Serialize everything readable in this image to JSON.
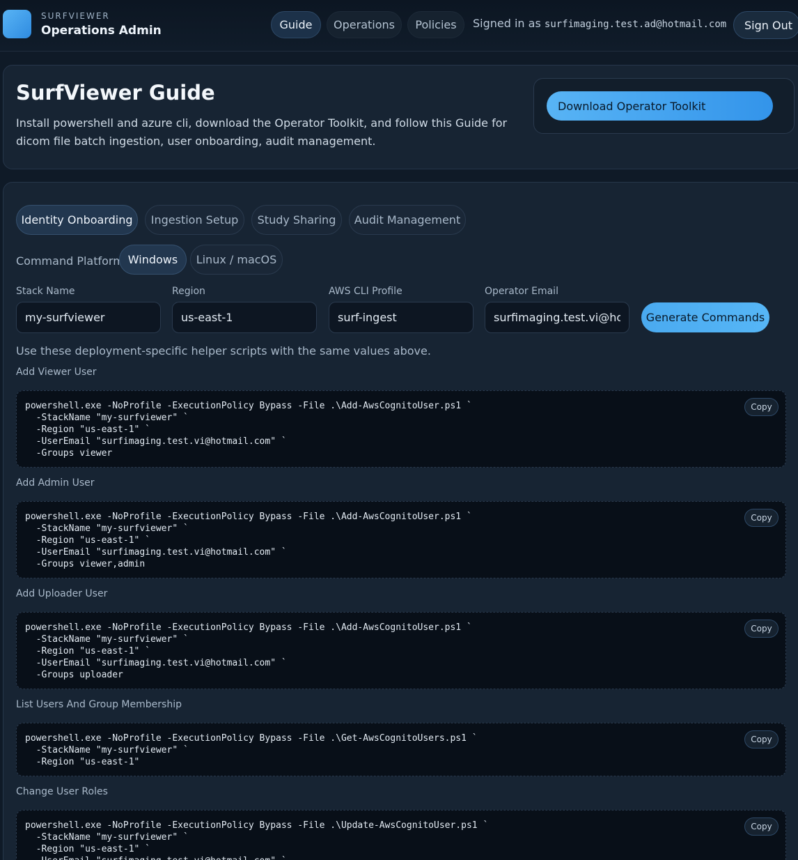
{
  "header": {
    "brand_small": "SURFVIEWER",
    "brand_title": "Operations Admin",
    "nav": [
      "Guide",
      "Operations",
      "Policies"
    ],
    "signed_prefix": "Signed in as",
    "signed_email": "surfimaging.test.ad@hotmail.com",
    "sign_out": "Sign Out"
  },
  "hero": {
    "title": "SurfViewer Guide",
    "description": "Install powershell and azure cli, download the Operator Toolkit, and follow this Guide for dicom file batch ingestion, user onboarding, audit management.",
    "download_label": "Download Operator Toolkit"
  },
  "tabs": [
    "Identity Onboarding",
    "Ingestion Setup",
    "Study Sharing",
    "Audit Management"
  ],
  "platform": {
    "label": "Command Platform",
    "options": [
      "Windows",
      "Linux / macOS"
    ]
  },
  "fields": {
    "stack_name": {
      "label": "Stack Name",
      "value": "my-surfviewer"
    },
    "region": {
      "label": "Region",
      "value": "us-east-1"
    },
    "profile": {
      "label": "AWS CLI Profile",
      "value": "surf-ingest"
    },
    "email": {
      "label": "Operator Email",
      "value": "surfimaging.test.vi@hotmail.com"
    }
  },
  "generate_label": "Generate Commands",
  "helper_text": "Use these deployment-specific helper scripts with the same values above.",
  "copy_label": "Copy",
  "sections": [
    {
      "label": "Add Viewer User",
      "code": "powershell.exe -NoProfile -ExecutionPolicy Bypass -File .\\Add-AwsCognitoUser.ps1 `\n  -StackName \"my-surfviewer\" `\n  -Region \"us-east-1\" `\n  -UserEmail \"surfimaging.test.vi@hotmail.com\" `\n  -Groups viewer"
    },
    {
      "label": "Add Admin User",
      "code": "powershell.exe -NoProfile -ExecutionPolicy Bypass -File .\\Add-AwsCognitoUser.ps1 `\n  -StackName \"my-surfviewer\" `\n  -Region \"us-east-1\" `\n  -UserEmail \"surfimaging.test.vi@hotmail.com\" `\n  -Groups viewer,admin"
    },
    {
      "label": "Add Uploader User",
      "code": "powershell.exe -NoProfile -ExecutionPolicy Bypass -File .\\Add-AwsCognitoUser.ps1 `\n  -StackName \"my-surfviewer\" `\n  -Region \"us-east-1\" `\n  -UserEmail \"surfimaging.test.vi@hotmail.com\" `\n  -Groups uploader"
    },
    {
      "label": "List Users And Group Membership",
      "code": "powershell.exe -NoProfile -ExecutionPolicy Bypass -File .\\Get-AwsCognitoUsers.ps1 `\n  -StackName \"my-surfviewer\" `\n  -Region \"us-east-1\""
    },
    {
      "label": "Change User Roles",
      "code": "powershell.exe -NoProfile -ExecutionPolicy Bypass -File .\\Update-AwsCognitoUser.ps1 `\n  -StackName \"my-surfviewer\" `\n  -Region \"us-east-1\" `\n  -UserEmail \"surfimaging.test.vi@hotmail.com\" `"
    }
  ]
}
